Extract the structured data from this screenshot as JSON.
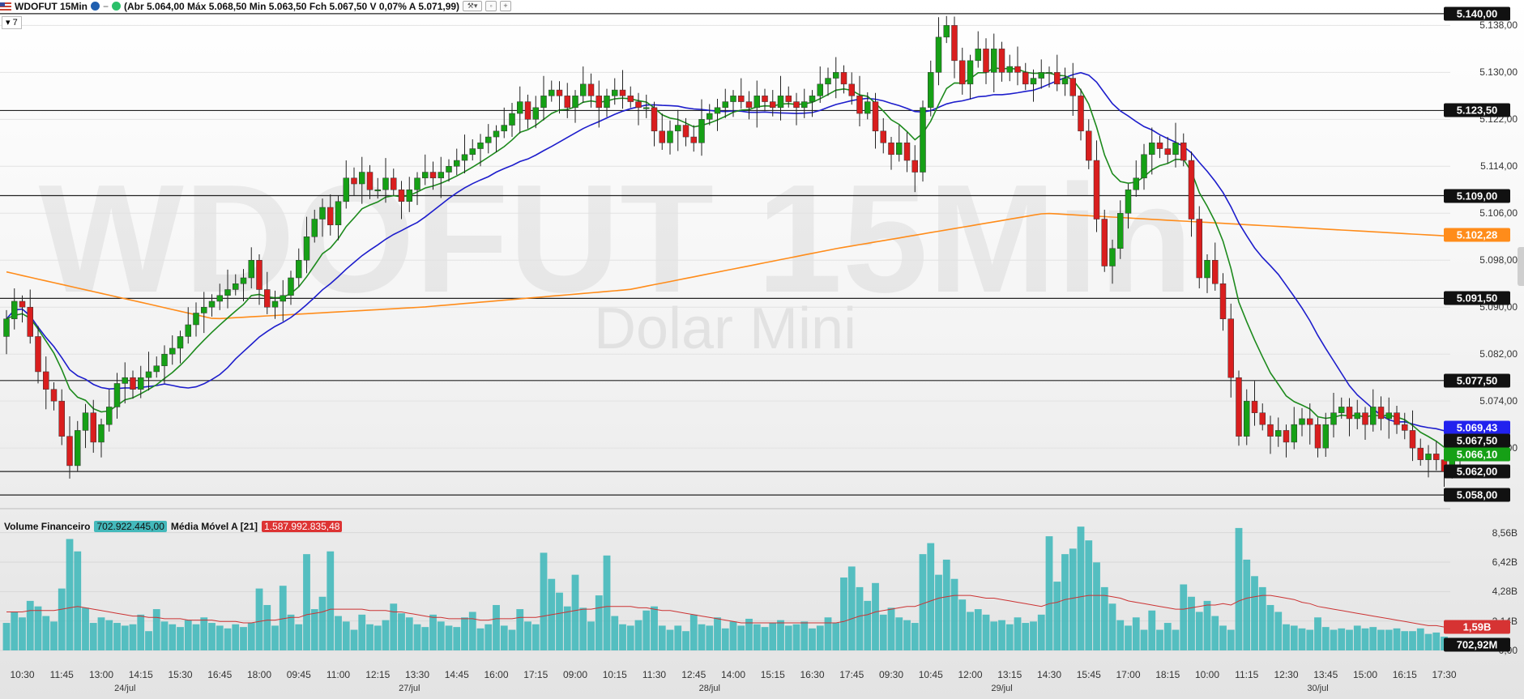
{
  "header": {
    "symbol": "WDOFUT 15Min",
    "ohlc": "(Abr 5.064,00 Máx 5.068,50 Min 5.063,50 Fch 5.067,50 V 0,07% A 5.071,99)",
    "period": "7",
    "watermark": "WDOFUT 15Min",
    "watermark_sub": "Dolar Mini"
  },
  "volume_legend": {
    "label": "Volume Financeiro",
    "value": "702.922.445,00",
    "ma_label": "Média Móvel A [21]",
    "ma_value": "1.587.992.835,48"
  },
  "colors": {
    "up": "#16a016",
    "down": "#d91e1e",
    "fast_ma": "#1d8a1d",
    "slow_ma": "#1d1dcc",
    "long_ma": "#ff8c1a",
    "volume": "#44b9bb",
    "volume_ma": "#cc3333"
  },
  "chart_data": [
    {
      "type": "candlestick",
      "ylim": [
        5056.5,
        5141.5
      ],
      "y_ticks": [
        "5.138,00",
        "5.130,00",
        "5.122,00",
        "5.114,00",
        "5.106,00",
        "5.098,00",
        "5.090,00",
        "5.082,00",
        "5.074,00",
        "5.066,00"
      ],
      "y_tick_values": [
        5138,
        5130,
        5122,
        5114,
        5106,
        5098,
        5090,
        5082,
        5074,
        5066
      ],
      "x_ticks": [
        "10:30",
        "11:45",
        "13:00",
        "14:15",
        "15:30",
        "16:45",
        "18:00",
        "09:45",
        "11:00",
        "12:15",
        "13:30",
        "14:45",
        "16:00",
        "17:15",
        "09:00",
        "10:15",
        "11:30",
        "12:45",
        "14:00",
        "15:15",
        "16:30",
        "17:45",
        "09:30",
        "10:45",
        "12:00",
        "13:15",
        "14:30",
        "15:45",
        "17:00",
        "18:15",
        "10:00",
        "11:15",
        "12:30",
        "13:45",
        "15:00",
        "16:15",
        "17:30"
      ],
      "x_tick_index": [
        2,
        7,
        12,
        17,
        22,
        27,
        32,
        37,
        42,
        47,
        52,
        57,
        62,
        67,
        72,
        77,
        82,
        87,
        92,
        97,
        102,
        107,
        112,
        117,
        122,
        127,
        132,
        137,
        142,
        147,
        152,
        157,
        162,
        167,
        172,
        177,
        182
      ],
      "date_labels": [
        "24/jul",
        "27/jul",
        "28/jul",
        "29/jul",
        "30/jul"
      ],
      "date_index": [
        15,
        51,
        89,
        126,
        166
      ],
      "levels": [
        {
          "value": 5140.0,
          "label": "5.140,00"
        },
        {
          "value": 5123.5,
          "label": "5.123,50"
        },
        {
          "value": 5109.0,
          "label": "5.109,00"
        },
        {
          "value": 5091.5,
          "label": "5.091,50"
        },
        {
          "value": 5077.5,
          "label": "5.077,50"
        },
        {
          "value": 5062.0,
          "label": "5.062,00"
        },
        {
          "value": 5058.0,
          "label": "5.058,00"
        }
      ],
      "ma_labels": [
        {
          "value": 5102.28,
          "label": "5.102,28",
          "series": "long"
        },
        {
          "value": 5069.43,
          "label": "5.069,43",
          "series": "slow"
        },
        {
          "value": 5067.5,
          "label": "5.067,50",
          "series": "last"
        },
        {
          "value": 5066.1,
          "label": "5.066,10",
          "series": "fast"
        }
      ],
      "key_closes": [
        [
          0,
          5088
        ],
        [
          1,
          5091
        ],
        [
          2,
          5090
        ],
        [
          3,
          5085
        ],
        [
          4,
          5079
        ],
        [
          5,
          5076
        ],
        [
          6,
          5074
        ],
        [
          7,
          5068
        ],
        [
          8,
          5063
        ],
        [
          9,
          5069
        ],
        [
          10,
          5072
        ],
        [
          11,
          5067
        ],
        [
          12,
          5070
        ],
        [
          13,
          5073
        ],
        [
          14,
          5077
        ],
        [
          15,
          5078
        ],
        [
          16,
          5076
        ],
        [
          17,
          5078
        ],
        [
          18,
          5079
        ],
        [
          19,
          5080
        ],
        [
          20,
          5082
        ],
        [
          21,
          5083
        ],
        [
          22,
          5085
        ],
        [
          23,
          5087
        ],
        [
          24,
          5089
        ],
        [
          25,
          5090
        ],
        [
          26,
          5091
        ],
        [
          27,
          5092
        ],
        [
          28,
          5093
        ],
        [
          29,
          5094
        ],
        [
          30,
          5095
        ],
        [
          31,
          5098
        ],
        [
          32,
          5093
        ],
        [
          33,
          5090
        ],
        [
          34,
          5091
        ],
        [
          35,
          5092
        ],
        [
          36,
          5095
        ],
        [
          37,
          5098
        ],
        [
          38,
          5102
        ],
        [
          39,
          5105
        ],
        [
          40,
          5107
        ],
        [
          41,
          5104
        ],
        [
          42,
          5108
        ],
        [
          43,
          5112
        ],
        [
          44,
          5111
        ],
        [
          45,
          5113
        ],
        [
          46,
          5110
        ],
        [
          47,
          5110
        ],
        [
          48,
          5112
        ],
        [
          49,
          5110
        ],
        [
          50,
          5108
        ],
        [
          51,
          5110
        ],
        [
          52,
          5112
        ],
        [
          53,
          5113
        ],
        [
          54,
          5112
        ],
        [
          55,
          5113
        ],
        [
          56,
          5114
        ],
        [
          57,
          5115
        ],
        [
          58,
          5116
        ],
        [
          59,
          5117
        ],
        [
          60,
          5118
        ],
        [
          61,
          5119
        ],
        [
          62,
          5120
        ],
        [
          63,
          5121
        ],
        [
          64,
          5123
        ],
        [
          65,
          5125
        ],
        [
          66,
          5122
        ],
        [
          67,
          5124
        ],
        [
          68,
          5126
        ],
        [
          69,
          5127
        ],
        [
          70,
          5126
        ],
        [
          71,
          5124
        ],
        [
          72,
          5126
        ],
        [
          73,
          5128
        ],
        [
          74,
          5126
        ],
        [
          75,
          5124
        ],
        [
          76,
          5126
        ],
        [
          77,
          5127
        ],
        [
          78,
          5126
        ],
        [
          79,
          5125
        ],
        [
          80,
          5124
        ],
        [
          81,
          5124
        ],
        [
          82,
          5120
        ],
        [
          83,
          5118
        ],
        [
          84,
          5120
        ],
        [
          85,
          5121
        ],
        [
          86,
          5119
        ],
        [
          87,
          5118
        ],
        [
          88,
          5122
        ],
        [
          89,
          5123
        ],
        [
          90,
          5124
        ],
        [
          91,
          5125
        ],
        [
          92,
          5126
        ],
        [
          93,
          5125
        ],
        [
          94,
          5124
        ],
        [
          95,
          5126
        ],
        [
          96,
          5125
        ],
        [
          97,
          5124
        ],
        [
          98,
          5126
        ],
        [
          99,
          5125
        ],
        [
          100,
          5124
        ],
        [
          101,
          5125
        ],
        [
          102,
          5126
        ],
        [
          103,
          5128
        ],
        [
          104,
          5129
        ],
        [
          105,
          5130
        ],
        [
          106,
          5128
        ],
        [
          107,
          5126
        ],
        [
          108,
          5123
        ],
        [
          109,
          5125
        ],
        [
          110,
          5120
        ],
        [
          111,
          5118
        ],
        [
          112,
          5116
        ],
        [
          113,
          5118
        ],
        [
          114,
          5115
        ],
        [
          115,
          5113
        ],
        [
          116,
          5124
        ],
        [
          117,
          5130
        ],
        [
          118,
          5136
        ],
        [
          119,
          5138
        ],
        [
          120,
          5132
        ],
        [
          121,
          5128
        ],
        [
          122,
          5132
        ],
        [
          123,
          5134
        ],
        [
          124,
          5130
        ],
        [
          125,
          5134
        ],
        [
          126,
          5130
        ],
        [
          127,
          5131
        ],
        [
          128,
          5130
        ],
        [
          129,
          5128
        ],
        [
          130,
          5129
        ],
        [
          131,
          5130
        ],
        [
          132,
          5130
        ],
        [
          133,
          5128
        ],
        [
          134,
          5129
        ],
        [
          135,
          5126
        ],
        [
          136,
          5120
        ],
        [
          137,
          5115
        ],
        [
          138,
          5105
        ],
        [
          139,
          5097
        ],
        [
          140,
          5100
        ],
        [
          141,
          5106
        ],
        [
          142,
          5110
        ],
        [
          143,
          5112
        ],
        [
          144,
          5116
        ],
        [
          145,
          5118
        ],
        [
          146,
          5117
        ],
        [
          147,
          5116
        ],
        [
          148,
          5118
        ],
        [
          149,
          5115
        ],
        [
          150,
          5105
        ],
        [
          151,
          5095
        ],
        [
          152,
          5098
        ],
        [
          153,
          5094
        ],
        [
          154,
          5088
        ],
        [
          155,
          5078
        ],
        [
          156,
          5068
        ],
        [
          157,
          5074
        ],
        [
          158,
          5072
        ],
        [
          159,
          5070
        ],
        [
          160,
          5068
        ],
        [
          161,
          5069
        ],
        [
          162,
          5067
        ],
        [
          163,
          5070
        ],
        [
          164,
          5071
        ],
        [
          165,
          5070
        ],
        [
          166,
          5066
        ],
        [
          167,
          5070
        ],
        [
          168,
          5072
        ],
        [
          169,
          5073
        ],
        [
          170,
          5071
        ],
        [
          171,
          5072
        ],
        [
          172,
          5070
        ],
        [
          173,
          5073
        ],
        [
          174,
          5071
        ],
        [
          175,
          5072
        ],
        [
          176,
          5070
        ],
        [
          177,
          5069
        ],
        [
          178,
          5066
        ],
        [
          179,
          5064
        ],
        [
          180,
          5065
        ],
        [
          181,
          5064
        ],
        [
          182,
          5062
        ],
        [
          183,
          5064
        ],
        [
          184,
          5067.5
        ]
      ]
    },
    {
      "type": "bar",
      "ylim": [
        0,
        9.6
      ],
      "y_ticks": [
        "8,56B",
        "6,42B",
        "4,28B",
        "2,14B",
        "0,00"
      ],
      "y_tick_values": [
        8.56,
        6.42,
        4.28,
        2.14,
        0
      ],
      "last_labels": [
        {
          "value": 1.59,
          "label": "1,59B",
          "series": "ma"
        },
        {
          "value": 0.7,
          "label": "702,92M",
          "series": "volume"
        }
      ],
      "values": [
        2.0,
        2.8,
        2.4,
        3.6,
        3.2,
        2.5,
        2.1,
        4.5,
        8.1,
        7.2,
        3.1,
        2.0,
        2.4,
        2.2,
        2.0,
        1.8,
        1.9,
        2.6,
        1.4,
        3.0,
        2.1,
        1.9,
        1.7,
        2.2,
        1.9,
        2.4,
        2.0,
        1.8,
        1.6,
        1.9,
        1.7,
        2.0,
        4.5,
        3.3,
        1.8,
        4.7,
        2.6,
        1.9,
        7.0,
        3.0,
        3.9,
        7.2,
        2.5,
        2.1,
        1.5,
        2.6,
        1.9,
        1.8,
        2.2,
        3.4,
        2.7,
        2.4,
        1.9,
        1.7,
        2.6,
        2.1,
        1.8,
        1.7,
        2.4,
        2.8,
        1.6,
        1.9,
        3.3,
        1.8,
        1.5,
        3.0,
        2.1,
        1.9,
        7.1,
        5.2,
        4.2,
        3.2,
        5.5,
        3.1,
        2.1,
        4.0,
        6.9,
        2.5,
        1.9,
        1.8,
        2.2,
        2.9,
        3.2,
        1.8,
        1.5,
        1.8,
        1.4,
        2.6,
        1.9,
        1.8,
        2.4,
        1.6,
        2.1,
        1.8,
        2.3,
        1.9,
        1.7,
        2.0,
        2.2,
        1.8,
        1.9,
        2.1,
        1.6,
        1.8,
        2.4,
        2.0,
        5.3,
        6.1,
        4.6,
        3.6,
        4.9,
        2.6,
        3.1,
        2.4,
        2.2,
        2.0,
        7.0,
        7.8,
        5.5,
        6.6,
        5.2,
        3.7,
        2.8,
        3.0,
        2.6,
        2.1,
        2.2,
        1.9,
        2.4,
        2.0,
        2.1,
        2.6,
        8.3,
        5.0,
        7.0,
        7.4,
        9.0,
        8.0,
        6.4,
        4.6,
        3.4,
        2.2,
        1.8,
        2.4,
        1.5,
        2.9,
        1.5,
        2.0,
        1.5,
        4.8,
        3.9,
        2.8,
        3.6,
        2.5,
        1.8,
        1.5,
        8.9,
        6.6,
        5.4,
        4.6,
        3.3,
        2.8,
        1.9,
        1.8,
        1.6,
        1.5,
        2.4,
        1.7,
        1.5,
        1.6,
        1.5,
        1.8,
        1.6,
        1.7,
        1.5,
        1.5,
        1.6,
        1.4,
        1.4,
        1.6,
        1.2,
        1.3,
        1.0,
        0.8,
        0.7
      ],
      "ma": [
        2.8,
        2.8,
        2.8,
        2.9,
        2.9,
        2.9,
        2.9,
        3.0,
        3.1,
        3.2,
        3.1,
        3.0,
        2.9,
        2.8,
        2.7,
        2.6,
        2.5,
        2.5,
        2.4,
        2.4,
        2.3,
        2.3,
        2.3,
        2.2,
        2.2,
        2.2,
        2.2,
        2.1,
        2.1,
        2.1,
        2.0,
        2.0,
        2.1,
        2.2,
        2.2,
        2.3,
        2.4,
        2.4,
        2.6,
        2.7,
        2.8,
        3.0,
        3.0,
        3.0,
        3.0,
        3.0,
        2.9,
        2.9,
        2.9,
        2.8,
        2.8,
        2.7,
        2.6,
        2.5,
        2.4,
        2.4,
        2.3,
        2.3,
        2.3,
        2.3,
        2.2,
        2.2,
        2.3,
        2.3,
        2.3,
        2.4,
        2.4,
        2.4,
        2.5,
        2.6,
        2.7,
        2.8,
        2.9,
        3.0,
        3.0,
        3.1,
        3.2,
        3.2,
        3.2,
        3.2,
        3.1,
        3.1,
        3.0,
        2.9,
        2.9,
        2.8,
        2.7,
        2.6,
        2.5,
        2.4,
        2.3,
        2.2,
        2.1,
        2.0,
        2.0,
        2.0,
        2.0,
        2.0,
        2.0,
        2.0,
        2.0,
        2.0,
        2.0,
        2.0,
        2.0,
        2.0,
        2.1,
        2.3,
        2.5,
        2.6,
        2.8,
        2.9,
        3.0,
        3.1,
        3.2,
        3.2,
        3.4,
        3.6,
        3.8,
        3.9,
        4.0,
        4.0,
        4.0,
        3.9,
        3.8,
        3.8,
        3.7,
        3.6,
        3.5,
        3.4,
        3.3,
        3.2,
        3.4,
        3.5,
        3.7,
        3.8,
        3.9,
        4.0,
        4.0,
        4.0,
        3.9,
        3.8,
        3.6,
        3.5,
        3.4,
        3.3,
        3.2,
        3.1,
        3.0,
        3.0,
        3.1,
        3.2,
        3.3,
        3.3,
        3.4,
        3.3,
        3.6,
        3.8,
        3.9,
        4.0,
        4.0,
        3.9,
        3.8,
        3.7,
        3.5,
        3.4,
        3.2,
        3.1,
        3.0,
        2.9,
        2.8,
        2.7,
        2.6,
        2.5,
        2.4,
        2.3,
        2.2,
        2.1,
        2.0,
        1.9,
        1.8,
        1.8,
        1.7,
        1.6,
        1.6
      ]
    }
  ]
}
